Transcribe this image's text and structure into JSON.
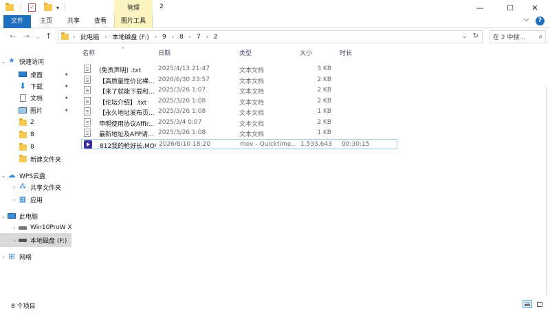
{
  "window": {
    "title": "2",
    "context_tab": "管理",
    "minimize": "—",
    "maximize": "☐",
    "close": "✕"
  },
  "ribbon": {
    "tabs": [
      "文件",
      "主页",
      "共享",
      "查看",
      "图片工具"
    ],
    "expand": "﹀",
    "help": "?"
  },
  "nav": {
    "back": "←",
    "forward": "→",
    "recent": "⌄",
    "up": "↑",
    "breadcrumb": [
      "此电脑",
      "本地磁盘 (F:)",
      "9",
      "8",
      "7",
      "2"
    ],
    "dropdown": "⌄",
    "refresh": "↻",
    "search_placeholder": "在 2 中搜..."
  },
  "sidebar": {
    "items": [
      {
        "label": "快速访问",
        "icon": "star-icon",
        "chev": "⌄",
        "pinned": false
      },
      {
        "label": "桌面",
        "icon": "desktop-icon",
        "chev": "",
        "pinned": true
      },
      {
        "label": "下载",
        "icon": "download-icon",
        "chev": "",
        "pinned": true
      },
      {
        "label": "文档",
        "icon": "document-icon",
        "chev": "",
        "pinned": true
      },
      {
        "label": "图片",
        "icon": "picture-icon",
        "chev": "",
        "pinned": true
      },
      {
        "label": "2",
        "icon": "folder-icon",
        "chev": "",
        "pinned": false
      },
      {
        "label": "8",
        "icon": "folder-icon",
        "chev": "",
        "pinned": false
      },
      {
        "label": "8",
        "icon": "folder-icon",
        "chev": "",
        "pinned": false
      },
      {
        "label": "新建文件夹",
        "icon": "folder-icon",
        "chev": "",
        "pinned": false
      },
      {
        "label": "WPS云盘",
        "icon": "cloud-icon",
        "chev": "⌄",
        "pinned": false
      },
      {
        "label": "共享文件夹",
        "icon": "share-icon",
        "chev": "›",
        "pinned": false
      },
      {
        "label": "应用",
        "icon": "apps-icon",
        "chev": "›",
        "pinned": false
      },
      {
        "label": "此电脑",
        "icon": "computer-icon",
        "chev": "⌄",
        "pinned": false
      },
      {
        "label": "Win10ProW X",
        "icon": "drive-icon",
        "chev": "›",
        "pinned": false
      },
      {
        "label": "本地磁盘 (F:)",
        "icon": "drive-icon",
        "chev": "›",
        "pinned": false
      },
      {
        "label": "网络",
        "icon": "network-icon",
        "chev": "›",
        "pinned": false
      }
    ],
    "pin_glyph": "📌"
  },
  "columns": [
    "名称",
    "日期",
    "类型",
    "大小",
    "时长"
  ],
  "sort_glyph": "^",
  "files": [
    {
      "name": "(免责声明) .txt",
      "date": "2025/4/13 21:47",
      "type": "文本文档",
      "size": "3 KB",
      "duration": "",
      "kind": "txt"
    },
    {
      "name": "【高质量性价比裸...",
      "date": "2026/6/30 23:57",
      "type": "文本文档",
      "size": "2 KB",
      "duration": "",
      "kind": "txt"
    },
    {
      "name": "【来了就能下载和...",
      "date": "2025/3/26 1:07",
      "type": "文本文档",
      "size": "2 KB",
      "duration": "",
      "kind": "txt"
    },
    {
      "name": "【论坛介绍】.txt",
      "date": "2025/3/26 1:08",
      "type": "文本文档",
      "size": "2 KB",
      "duration": "",
      "kind": "txt"
    },
    {
      "name": "【永久地址发布页...",
      "date": "2025/3/26 1:08",
      "type": "文本文档",
      "size": "1 KB",
      "duration": "",
      "kind": "txt"
    },
    {
      "name": "申明使用协议Affir...",
      "date": "2025/3/4 0:07",
      "type": "文本文档",
      "size": "2 KB",
      "duration": "",
      "kind": "txt"
    },
    {
      "name": "最新地址及APP请...",
      "date": "2025/3/26 1:08",
      "type": "文本文档",
      "size": "1 KB",
      "duration": "",
      "kind": "txt"
    },
    {
      "name": "812我的枪好长.MOV",
      "date": "2026/8/10 18:20",
      "type": "mov - Quicktime...",
      "size": "1,533,643...",
      "duration": "00:30:15",
      "kind": "mov"
    }
  ],
  "status": {
    "item_count": "8 个项目"
  }
}
